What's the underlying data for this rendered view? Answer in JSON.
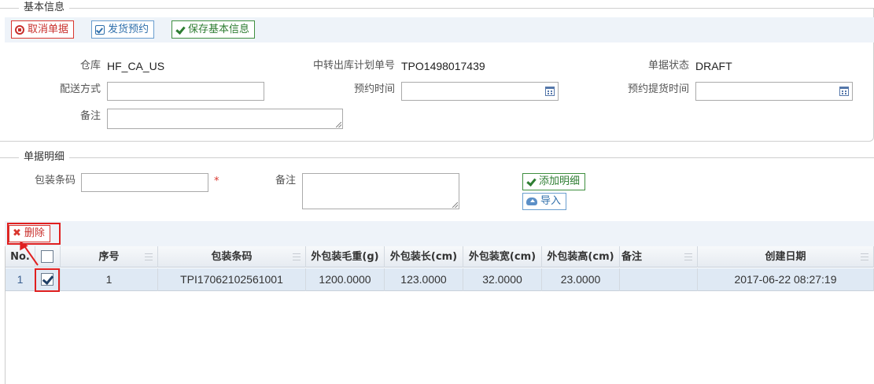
{
  "basic": {
    "legend": "基本信息",
    "toolbar": {
      "cancel_label": "取消单据",
      "book_label": "发货预约",
      "save_label": "保存基本信息"
    },
    "fields": {
      "warehouse_label": "仓库",
      "warehouse_value": "HF_CA_US",
      "plan_no_label": "中转出库计划单号",
      "plan_no_value": "TPO1498017439",
      "status_label": "单据状态",
      "status_value": "DRAFT",
      "delivery_label": "配送方式",
      "delivery_value": "",
      "appt_time_label": "预约时间",
      "appt_time_value": "",
      "pickup_time_label": "预约提货时间",
      "pickup_time_value": "",
      "remark_label": "备注",
      "remark_value": ""
    }
  },
  "detail": {
    "legend": "单据明细",
    "barcode_label": "包装条码",
    "barcode_value": "",
    "required_mark": "*",
    "remark_label": "备注",
    "remark_value": "",
    "add_label": "添加明细",
    "import_label": "导入"
  },
  "grid": {
    "delete_label": "删除",
    "columns": [
      "No.",
      "",
      "序号",
      "包装条码",
      "外包装毛重(g)",
      "外包装长(cm)",
      "外包装宽(cm)",
      "外包装高(cm)",
      "备注",
      "创建日期"
    ],
    "rows": [
      {
        "no": "1",
        "checked": true,
        "seq": "1",
        "barcode": "TPI17062102561001",
        "weight": "1200.0000",
        "length": "123.0000",
        "width": "32.0000",
        "height": "23.0000",
        "remark": "",
        "created": "2017-06-22 08:27:19"
      }
    ]
  },
  "colors": {
    "danger": "#c9302c",
    "primary": "#2f6fab",
    "success": "#2e7d32",
    "highlight": "#e02020",
    "toolbar_bg": "#eef3f9",
    "row_selected": "#dfe9f4"
  }
}
